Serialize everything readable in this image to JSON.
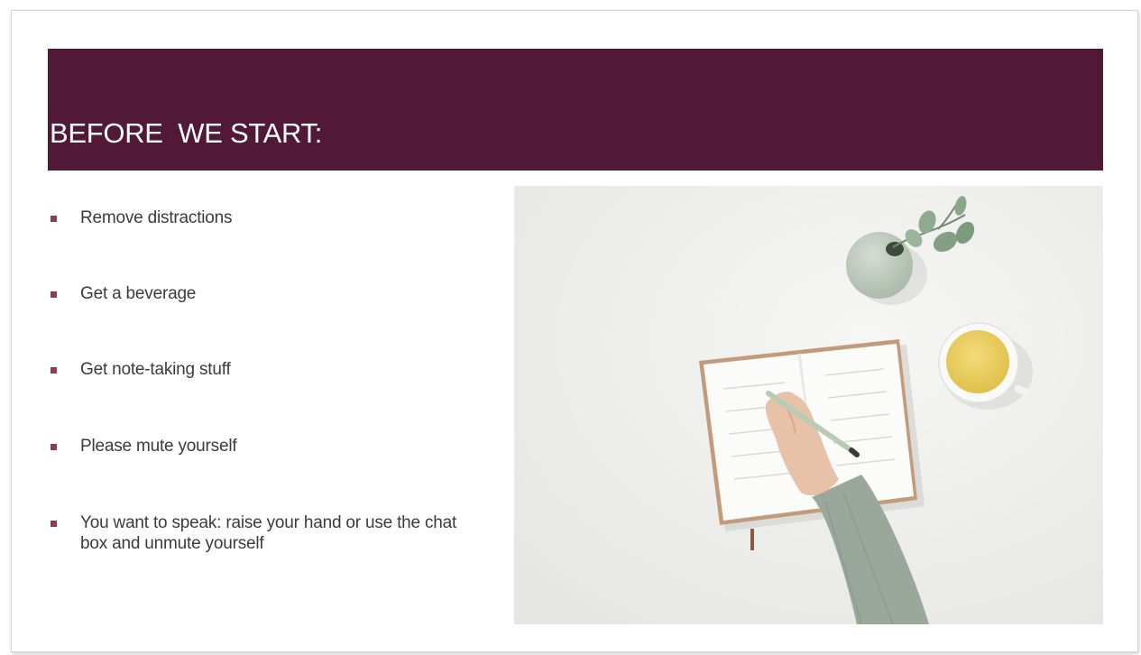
{
  "slide": {
    "title": "BEFORE  WE START:",
    "bullets": [
      "Remove distractions",
      "Get a beverage",
      "Get note-taking stuff",
      "Please mute yourself",
      "You want to speak:  raise your hand or use the chat box and unmute yourself"
    ]
  },
  "colors": {
    "title_bar": "#521838",
    "bullet_marker": "#8f3a5a",
    "body_text": "#3b3b3b"
  },
  "icons": {
    "bullet": "square-bullet-icon"
  }
}
